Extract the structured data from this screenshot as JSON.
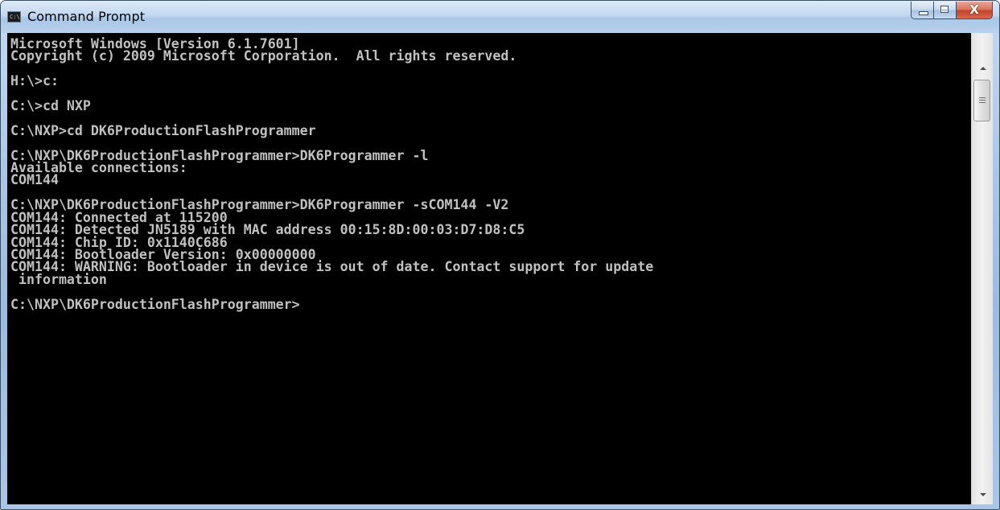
{
  "window": {
    "title": "Command Prompt",
    "icon": "console-icon",
    "icon_text": "C:\\."
  },
  "caption_buttons": {
    "minimize": "minimize-icon",
    "maximize": "maximize-icon",
    "close": "close-icon",
    "close_glyph": "X"
  },
  "console": {
    "foreground": "#c0c0c0",
    "background": "#000000",
    "text": "Microsoft Windows [Version 6.1.7601]\nCopyright (c) 2009 Microsoft Corporation.  All rights reserved.\n\nH:\\>c:\n\nC:\\>cd NXP\n\nC:\\NXP>cd DK6ProductionFlashProgrammer\n\nC:\\NXP\\DK6ProductionFlashProgrammer>DK6Programmer -l\nAvailable connections:\nCOM144\n\nC:\\NXP\\DK6ProductionFlashProgrammer>DK6Programmer -sCOM144 -V2\nCOM144: Connected at 115200\nCOM144: Detected JN5189 with MAC address 00:15:8D:00:03:D7:D8:C5\nCOM144: Chip ID: 0x1140C686\nCOM144: Bootloader Version: 0x00000000\nCOM144: WARNING: Bootloader in device is out of date. Contact support for update\n information\n\nC:\\NXP\\DK6ProductionFlashProgrammer>"
  },
  "scrollbar": {
    "up_arrow": "arrow-up-icon",
    "down_arrow": "arrow-down-icon"
  }
}
